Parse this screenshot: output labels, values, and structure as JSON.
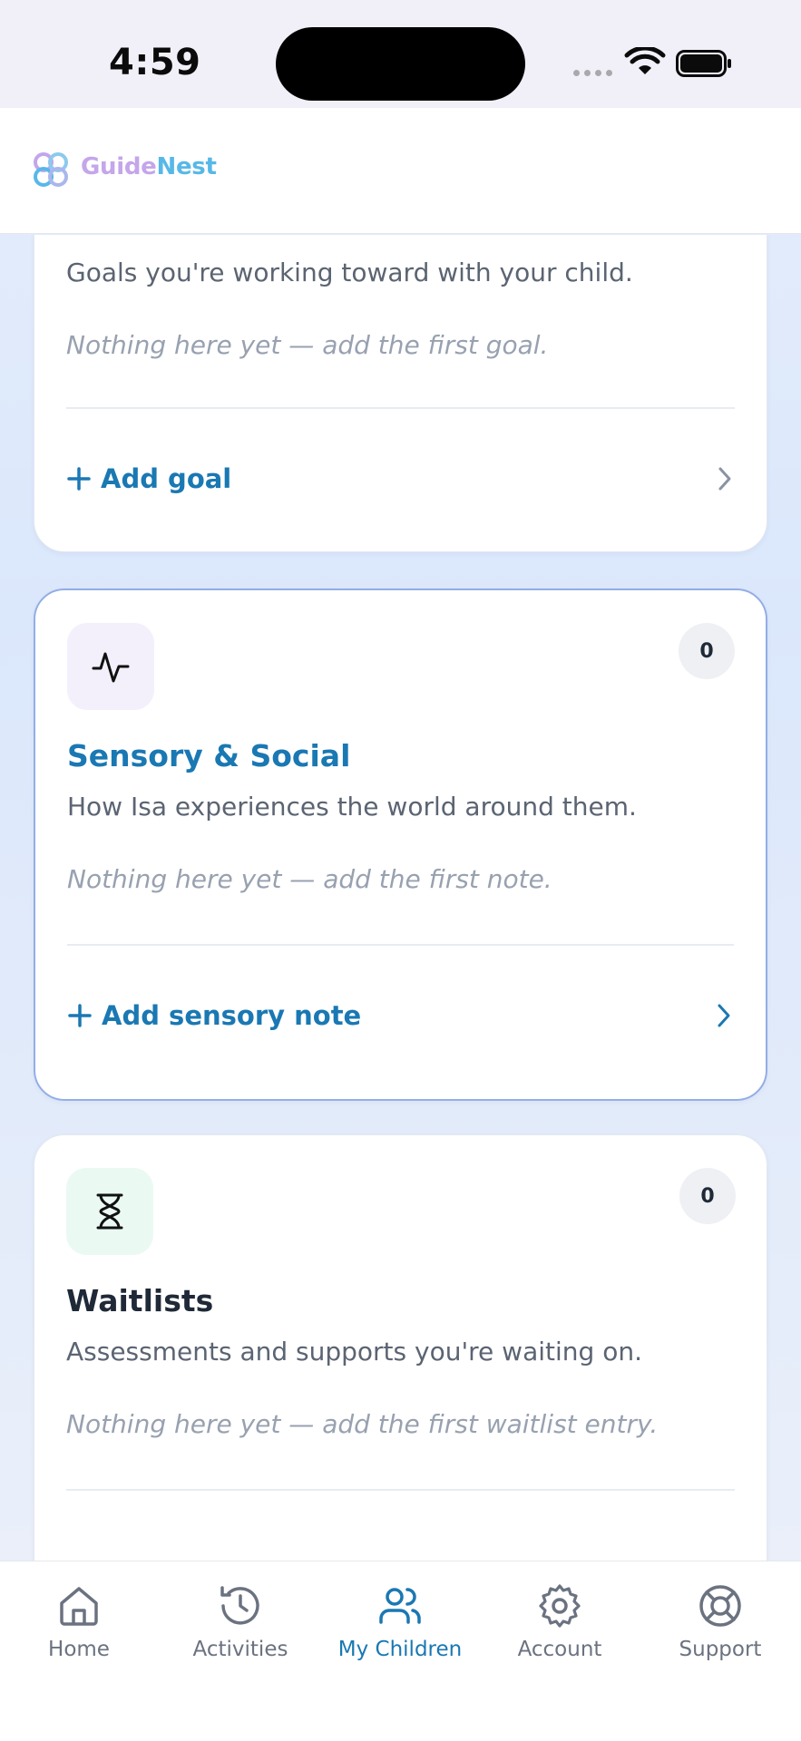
{
  "status_bar": {
    "time": "4:59"
  },
  "header": {
    "logo_part1": "Guide",
    "logo_part2": "Nest"
  },
  "cards": [
    {
      "id": "goals",
      "description": "Goals you're working toward with your child.",
      "empty_text": "Nothing here yet — add the first goal.",
      "action_label": "Add goal"
    },
    {
      "id": "sensory",
      "title": "Sensory & Social",
      "description": "How Isa experiences the world around them.",
      "empty_text": "Nothing here yet — add the first note.",
      "action_label": "Add sensory note",
      "count": "0",
      "icon": "activity-icon"
    },
    {
      "id": "waitlists",
      "title": "Waitlists",
      "description": "Assessments and supports you're waiting on.",
      "empty_text": "Nothing here yet — add the first waitlist entry.",
      "count": "0",
      "icon": "hourglass-icon"
    }
  ],
  "nav": {
    "items": [
      {
        "label": "Home",
        "icon": "home-icon"
      },
      {
        "label": "Activities",
        "icon": "history-icon"
      },
      {
        "label": "My Children",
        "icon": "users-icon",
        "active": true
      },
      {
        "label": "Account",
        "icon": "gear-icon"
      },
      {
        "label": "Support",
        "icon": "lifebuoy-icon"
      }
    ]
  },
  "colors": {
    "accent": "#1a78b3",
    "highlight_border": "#93aee6",
    "sensory_icon_bg": "#f3f0fc",
    "waitlist_icon_bg": "#eafaf3"
  }
}
